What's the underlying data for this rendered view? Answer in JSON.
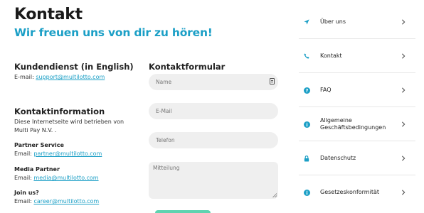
{
  "page": {
    "title": "Kontakt",
    "subtitle": "Wir freuen uns von dir zu hören!"
  },
  "support": {
    "heading": "Kundendienst (in English)",
    "email_label": "E-mail:",
    "email": "support@multilotto.com"
  },
  "info": {
    "heading": "Kontaktinformation",
    "description": "Diese Internetseite wird betrieben von Multi Pay N.V. .",
    "contacts": [
      {
        "title": "Partner Service",
        "label": "Email:",
        "email": "partner@multilotto.com"
      },
      {
        "title": "Media Partner",
        "label": "Email:",
        "email": "media@multilotto.com"
      },
      {
        "title": "Join us?",
        "label": "Email:",
        "email": "career@multilotto.com"
      }
    ]
  },
  "form": {
    "heading": "Kontaktformular",
    "name_placeholder": "Name",
    "email_placeholder": "E-Mail",
    "phone_placeholder": "Telefon",
    "message_placeholder": "Mitteilung"
  },
  "sidebar": {
    "items": [
      {
        "label": "Über uns",
        "icon": "location-arrow-icon"
      },
      {
        "label": "Kontakt",
        "icon": "phone-icon"
      },
      {
        "label": "FAQ",
        "icon": "question-circle-icon"
      },
      {
        "label": "Allgemeine Geschäftsbedingungen",
        "icon": "info-circle-icon"
      },
      {
        "label": "Datenschutz",
        "icon": "lock-icon"
      },
      {
        "label": "Gesetzeskonformität",
        "icon": "info-circle-icon"
      }
    ]
  },
  "colors": {
    "accent": "#1b9fc6",
    "submit": "#5fd3b0"
  }
}
